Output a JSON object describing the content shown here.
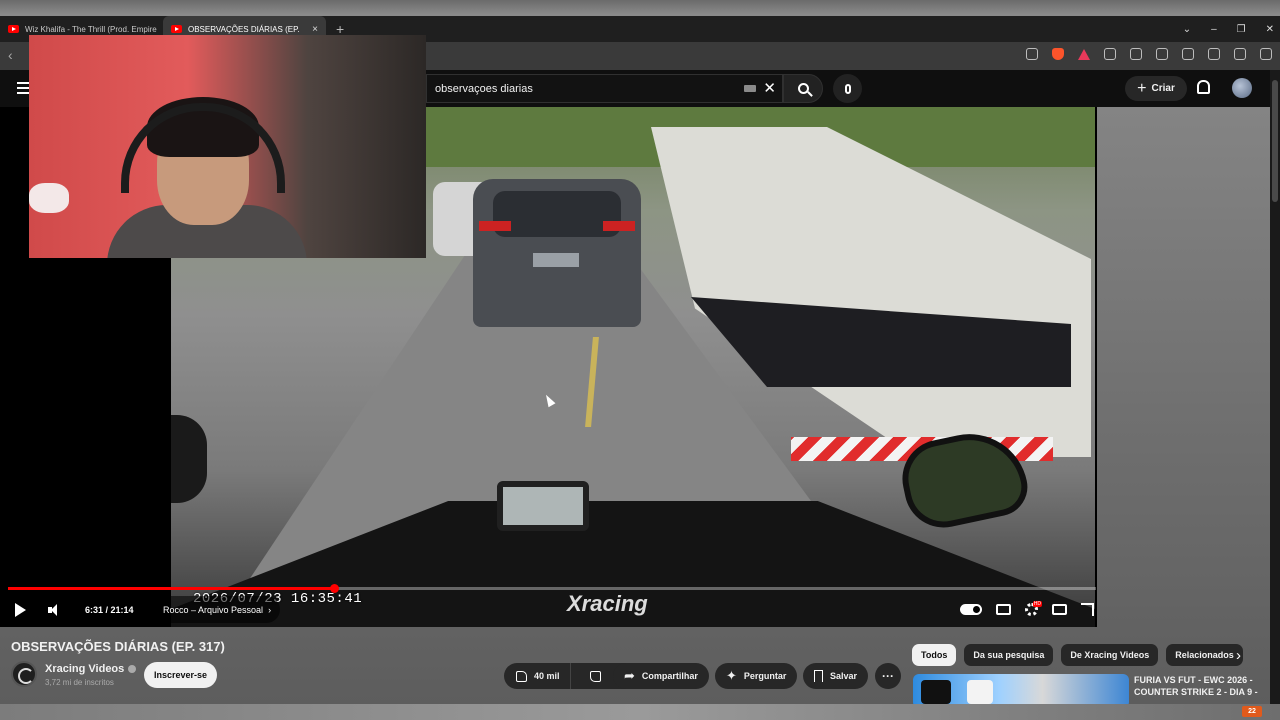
{
  "browser": {
    "tabs": [
      {
        "label": "Wiz Khalifa - The Thrill (Prod. Empire"
      },
      {
        "label": "OBSERVAÇÕES DIÁRIAS (EP. ",
        "active": true
      }
    ],
    "new_tab": "+",
    "close_tab": "×",
    "back": "‹"
  },
  "header": {
    "search_query": "observaçoes diarias",
    "clear": "✕",
    "create_label": "Criar",
    "create_plus": "+"
  },
  "player": {
    "time": "6:31 / 21:14",
    "chapter": "Rocco – Arquivo Pessoal",
    "chapter_chevron": "›",
    "progress_fraction": 0.3,
    "overlay_timestamp": "2026/07/23  16:35:41",
    "watermark": "Xracing"
  },
  "video": {
    "title": "OBSERVAÇÕES DIÁRIAS (EP. 317)",
    "channel": "Xracing Videos",
    "subscribers": "3,72 mi de inscritos",
    "subscribe_label": "Inscrever-se",
    "likes": "40 mil",
    "share_label": "Compartilhar",
    "ask_label": "Perguntar",
    "save_label": "Salvar",
    "more": "···"
  },
  "chips": [
    "Todos",
    "Da sua pesquisa",
    "De Xracing Videos",
    "Relacionados"
  ],
  "chips_next": "›",
  "recommendation": {
    "title": "FURIA VS FUT - EWC 2026 - COUNTER STRIKE 2 - DIA 9 -"
  },
  "taskbar": {
    "badge": "22"
  },
  "colors": {
    "accent": "#ff0000",
    "background": "#0f0f0f",
    "chip_active": "#f1f1f1"
  }
}
